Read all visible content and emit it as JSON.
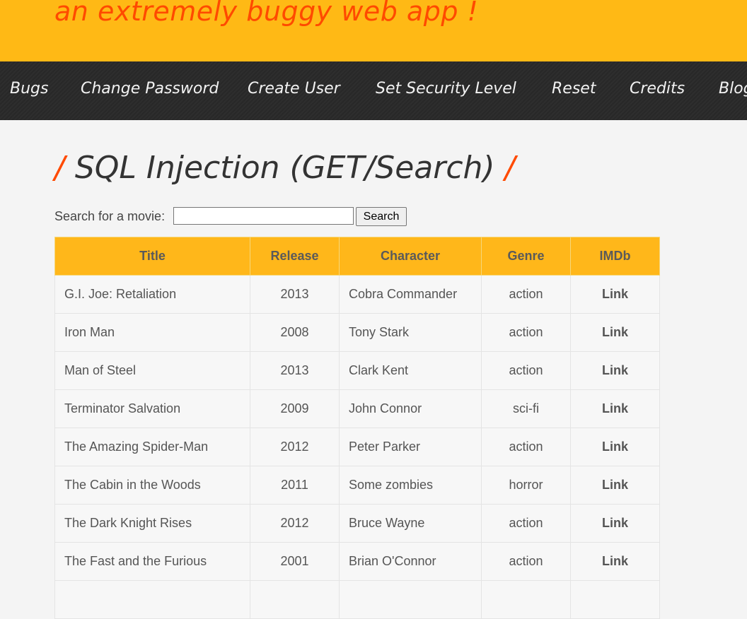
{
  "header": {
    "tagline": "an extremely buggy web app !"
  },
  "menu": {
    "items": [
      "Bugs",
      "Change Password",
      "Create User",
      "Set Security Level",
      "Reset",
      "Credits",
      "Blog"
    ]
  },
  "page": {
    "title": "SQL Injection (GET/Search)",
    "title_slash": "/"
  },
  "search": {
    "label": "Search for a movie:",
    "value": "",
    "placeholder": "",
    "button_label": "Search"
  },
  "table": {
    "headers": [
      "Title",
      "Release",
      "Character",
      "Genre",
      "IMDb"
    ],
    "rows": [
      {
        "title": "G.I. Joe: Retaliation",
        "release": "2013",
        "character": "Cobra Commander",
        "genre": "action",
        "imdb": "Link"
      },
      {
        "title": "Iron Man",
        "release": "2008",
        "character": "Tony Stark",
        "genre": "action",
        "imdb": "Link"
      },
      {
        "title": "Man of Steel",
        "release": "2013",
        "character": "Clark Kent",
        "genre": "action",
        "imdb": "Link"
      },
      {
        "title": "Terminator Salvation",
        "release": "2009",
        "character": "John Connor",
        "genre": "sci-fi",
        "imdb": "Link"
      },
      {
        "title": "The Amazing Spider-Man",
        "release": "2012",
        "character": "Peter Parker",
        "genre": "action",
        "imdb": "Link"
      },
      {
        "title": "The Cabin in the Woods",
        "release": "2011",
        "character": "Some zombies",
        "genre": "horror",
        "imdb": "Link"
      },
      {
        "title": "The Dark Knight Rises",
        "release": "2012",
        "character": "Bruce Wayne",
        "genre": "action",
        "imdb": "Link"
      },
      {
        "title": "The Fast and the Furious",
        "release": "2001",
        "character": "Brian O'Connor",
        "genre": "action",
        "imdb": "Link"
      },
      {
        "title": "",
        "release": "",
        "character": "",
        "genre": "",
        "imdb": ""
      }
    ]
  },
  "colors": {
    "header_bg": "#ffb915",
    "accent": "#ff4a00",
    "menu_bg": "#2a2a2a",
    "table_header_bg": "#ffb71a"
  }
}
